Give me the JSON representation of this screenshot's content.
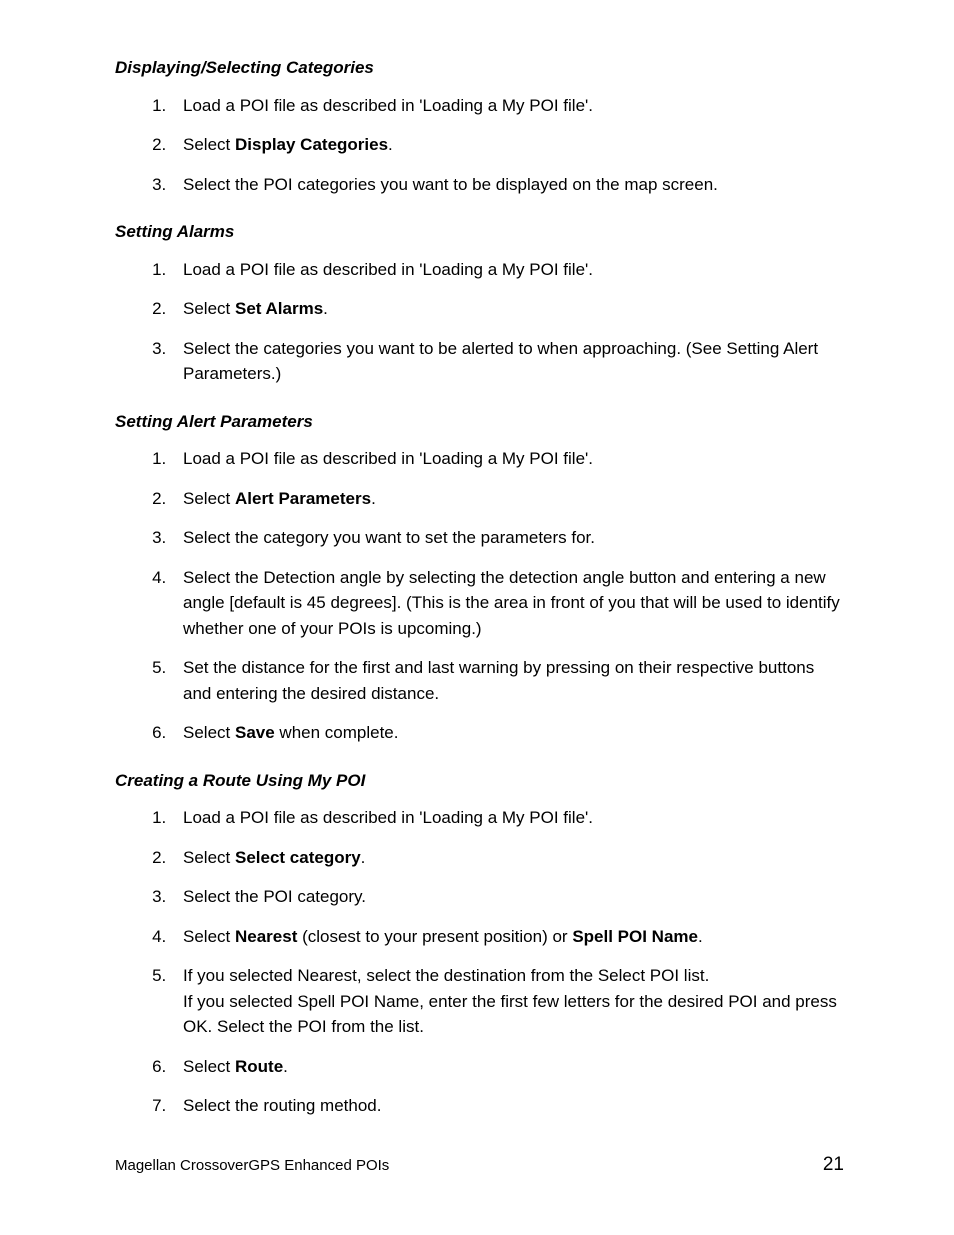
{
  "sections": [
    {
      "heading": "Displaying/Selecting Categories",
      "items": [
        [
          {
            "t": "Load a POI file as described in 'Loading a My POI file'."
          }
        ],
        [
          {
            "t": "Select "
          },
          {
            "t": "Display Categories",
            "b": true
          },
          {
            "t": "."
          }
        ],
        [
          {
            "t": "Select the POI categories you want to be displayed on the map screen."
          }
        ]
      ]
    },
    {
      "heading": "Setting Alarms",
      "items": [
        [
          {
            "t": "Load a POI file as described in 'Loading a My POI file'."
          }
        ],
        [
          {
            "t": "Select "
          },
          {
            "t": "Set Alarms",
            "b": true
          },
          {
            "t": "."
          }
        ],
        [
          {
            "t": "Select the categories you want to be alerted to when approaching. (See Setting Alert Parameters.)"
          }
        ]
      ]
    },
    {
      "heading": "Setting Alert Parameters",
      "items": [
        [
          {
            "t": "Load a POI file as described in 'Loading a My POI file'."
          }
        ],
        [
          {
            "t": "Select "
          },
          {
            "t": "Alert Parameters",
            "b": true
          },
          {
            "t": "."
          }
        ],
        [
          {
            "t": "Select the category you want to set the parameters for."
          }
        ],
        [
          {
            "t": "Select the Detection angle by selecting the detection angle button and entering a new angle [default is 45 degrees]. (This is the area in front of you that will be used to identify whether one of your POIs is upcoming.)"
          }
        ],
        [
          {
            "t": "Set the distance for the first and last warning by pressing on their respective buttons and entering the desired distance."
          }
        ],
        [
          {
            "t": "Select "
          },
          {
            "t": "Save",
            "b": true
          },
          {
            "t": " when complete."
          }
        ]
      ]
    },
    {
      "heading": "Creating a Route Using My POI",
      "items": [
        [
          {
            "t": "Load a POI file as described in 'Loading a My POI file'."
          }
        ],
        [
          {
            "t": "Select "
          },
          {
            "t": "Select category",
            "b": true
          },
          {
            "t": "."
          }
        ],
        [
          {
            "t": "Select the POI category."
          }
        ],
        [
          {
            "t": "Select "
          },
          {
            "t": "Nearest",
            "b": true
          },
          {
            "t": " (closest to your present position) or "
          },
          {
            "t": "Spell POI Name",
            "b": true
          },
          {
            "t": "."
          }
        ],
        [
          {
            "t": "If you selected Nearest, select the destination from the Select POI list."
          },
          {
            "br": true
          },
          {
            "t": "If you selected Spell POI Name, enter the first few letters for the desired POI and press OK. Select the POI from the list."
          }
        ],
        [
          {
            "t": "Select "
          },
          {
            "t": "Route",
            "b": true
          },
          {
            "t": "."
          }
        ],
        [
          {
            "t": "Select the routing method."
          }
        ]
      ]
    }
  ],
  "footer": {
    "left": "Magellan CrossoverGPS Enhanced POIs",
    "right": "21"
  }
}
